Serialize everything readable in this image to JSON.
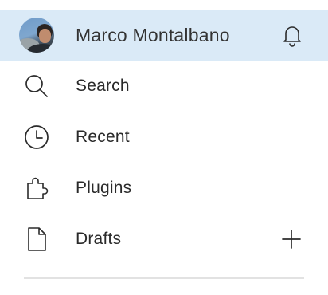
{
  "user": {
    "name": "Marco Montalbano"
  },
  "nav": {
    "items": [
      {
        "label": "Search",
        "icon": "search-icon"
      },
      {
        "label": "Recent",
        "icon": "clock-icon"
      },
      {
        "label": "Plugins",
        "icon": "puzzle-icon"
      },
      {
        "label": "Drafts",
        "icon": "file-icon"
      }
    ]
  },
  "colors": {
    "active_row_bg": "#daeaf7",
    "text": "#2a2a2a",
    "icon_stroke": "#2b2b2b",
    "divider": "#e2e2e2"
  }
}
